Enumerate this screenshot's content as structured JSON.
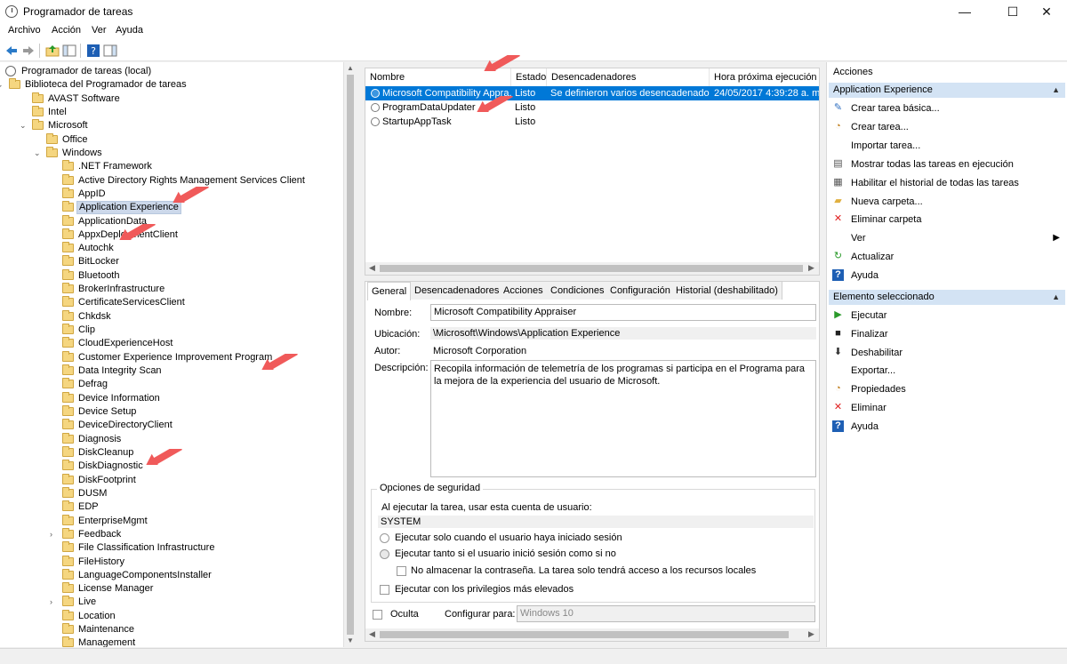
{
  "window": {
    "title": "Programador de tareas",
    "controls": {
      "minimize": "—",
      "maximize": "☐",
      "close": "✕"
    }
  },
  "menu": [
    "Archivo",
    "Acción",
    "Ver",
    "Ayuda"
  ],
  "tree": {
    "root": "Programador de tareas (local)",
    "library": "Biblioteca del Programador de tareas",
    "items": [
      "AVAST Software",
      "Intel",
      "Microsoft",
      "Office",
      "Windows",
      ".NET Framework",
      "Active Directory Rights Management Services Client",
      "AppID",
      "Application Experience",
      "ApplicationData",
      "AppxDeploymentClient",
      "Autochk",
      "BitLocker",
      "Bluetooth",
      "BrokerInfrastructure",
      "CertificateServicesClient",
      "Chkdsk",
      "Clip",
      "CloudExperienceHost",
      "Customer Experience Improvement Program",
      "Data Integrity Scan",
      "Defrag",
      "Device Information",
      "Device Setup",
      "DeviceDirectoryClient",
      "Diagnosis",
      "DiskCleanup",
      "DiskDiagnostic",
      "DiskFootprint",
      "DUSM",
      "EDP",
      "EnterpriseMgmt",
      "Feedback",
      "File Classification Infrastructure",
      "FileHistory",
      "LanguageComponentsInstaller",
      "License Manager",
      "Live",
      "Location",
      "Maintenance",
      "Management"
    ]
  },
  "tasks": {
    "columns": [
      "Nombre",
      "Estado",
      "Desencadenadores",
      "Hora próxima ejecución"
    ],
    "rows": [
      {
        "name": "Microsoft Compatibility Appra...",
        "status": "Listo",
        "triggers": "Se definieron varios desencadenadores",
        "next": "24/05/2017 4:39:28 a. m."
      },
      {
        "name": "ProgramDataUpdater",
        "status": "Listo",
        "triggers": "",
        "next": ""
      },
      {
        "name": "StartupAppTask",
        "status": "Listo",
        "triggers": "",
        "next": ""
      }
    ]
  },
  "details": {
    "tabs": [
      "General",
      "Desencadenadores",
      "Acciones",
      "Condiciones",
      "Configuración",
      "Historial (deshabilitado)"
    ],
    "name_label": "Nombre:",
    "name_value": "Microsoft Compatibility Appraiser",
    "location_label": "Ubicación:",
    "location_value": "\\Microsoft\\Windows\\Application Experience",
    "author_label": "Autor:",
    "author_value": "Microsoft Corporation",
    "description_label": "Descripción:",
    "description_value": "Recopila información de telemetría de los programas si participa en el Programa para la mejora de la experiencia del usuario de Microsoft.",
    "security_title": "Opciones de seguridad",
    "run_as_label": "Al ejecutar la tarea, usar esta cuenta de usuario:",
    "run_as_value": "SYSTEM",
    "radio_logged_on": "Ejecutar solo cuando el usuario haya iniciado sesión",
    "radio_whether": "Ejecutar tanto si el usuario inició sesión como si no",
    "no_store_password": "No almacenar la contraseña. La tarea solo tendrá acceso a los recursos locales",
    "highest_privileges": "Ejecutar con los privilegios más elevados",
    "hidden_label": "Oculta",
    "configure_label": "Configurar para:",
    "configure_value": "Windows 10"
  },
  "actions": {
    "header": "Acciones",
    "section1": "Application Experience",
    "items1": [
      {
        "label": "Crear tarea básica...",
        "icon": "wand-icon"
      },
      {
        "label": "Crear tarea...",
        "icon": "new-task-icon"
      },
      {
        "label": "Importar tarea...",
        "icon": ""
      },
      {
        "label": "Mostrar todas las tareas en ejecución",
        "icon": "running-tasks-icon"
      },
      {
        "label": "Habilitar el historial de todas las tareas",
        "icon": "history-icon"
      },
      {
        "label": "Nueva carpeta...",
        "icon": "folder-icon"
      },
      {
        "label": "Eliminar carpeta",
        "icon": "delete-icon"
      },
      {
        "label": "Ver",
        "icon": ""
      },
      {
        "label": "Actualizar",
        "icon": "refresh-icon"
      },
      {
        "label": "Ayuda",
        "icon": "help-icon"
      }
    ],
    "section2": "Elemento seleccionado",
    "items2": [
      {
        "label": "Ejecutar",
        "icon": "play-icon"
      },
      {
        "label": "Finalizar",
        "icon": "stop-icon"
      },
      {
        "label": "Deshabilitar",
        "icon": "disable-icon"
      },
      {
        "label": "Exportar...",
        "icon": ""
      },
      {
        "label": "Propiedades",
        "icon": "properties-icon"
      },
      {
        "label": "Eliminar",
        "icon": "delete-icon"
      },
      {
        "label": "Ayuda",
        "icon": "help-icon"
      }
    ]
  },
  "colors": {
    "selection": "#0078d7",
    "section_bg": "#d3e3f4",
    "arrow": "#f05a5a"
  }
}
